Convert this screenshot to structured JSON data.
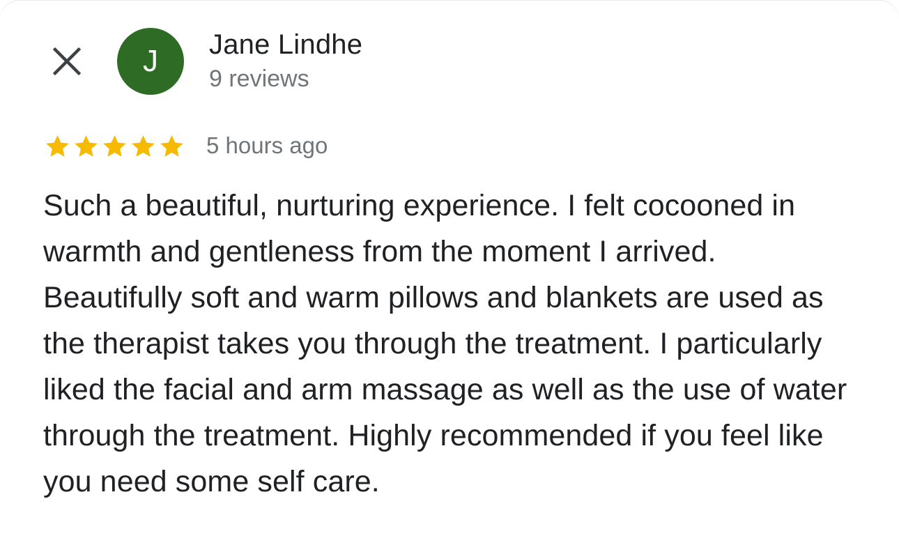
{
  "review": {
    "author": {
      "name": "Jane Lindhe",
      "initial": "J",
      "review_count": "9 reviews",
      "avatar_color": "#2e6b25"
    },
    "rating": 5,
    "rating_max": 5,
    "star_color": "#f6bb00",
    "time_ago": "5 hours ago",
    "text": "Such a beautiful, nurturing experience. I felt cocooned in warmth and gentleness from the moment I arrived. Beautifully soft and warm pillows and blankets are used as the therapist takes you through the treatment. I particularly liked the facial and arm massage as well as the use of water through the treatment. Highly recommended if you feel like you need some self care."
  },
  "icons": {
    "close": "close-icon",
    "star": "star-icon"
  }
}
